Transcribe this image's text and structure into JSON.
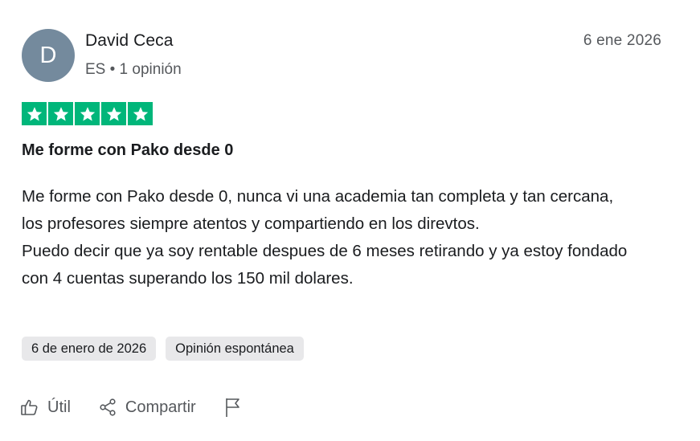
{
  "reviewer": {
    "initial": "D",
    "name": "David Ceca",
    "meta": "ES • 1 opinión",
    "avatar_color": "#748a9d"
  },
  "review": {
    "date_short": "6 ene 2026",
    "rating": 5,
    "star_color": "#00b67a",
    "title": "Me forme con Pako desde 0",
    "body_line1": "Me forme con Pako desde 0, nunca vi una academia tan completa y tan cercana, los profesores siempre atentos y compartiendo en los direvtos.",
    "body_line2": "Puedo decir que ya soy rentable despues de 6 meses retirando y ya estoy fondado con 4 cuentas superando los 150 mil dolares."
  },
  "tags": {
    "date_tag": "6 de enero de 2026",
    "type_tag": "Opinión espontánea"
  },
  "actions": {
    "useful_label": "Útil",
    "share_label": "Compartir",
    "useful_icon": "thumbs-up-icon",
    "share_icon": "share-icon",
    "report_icon": "flag-icon"
  }
}
